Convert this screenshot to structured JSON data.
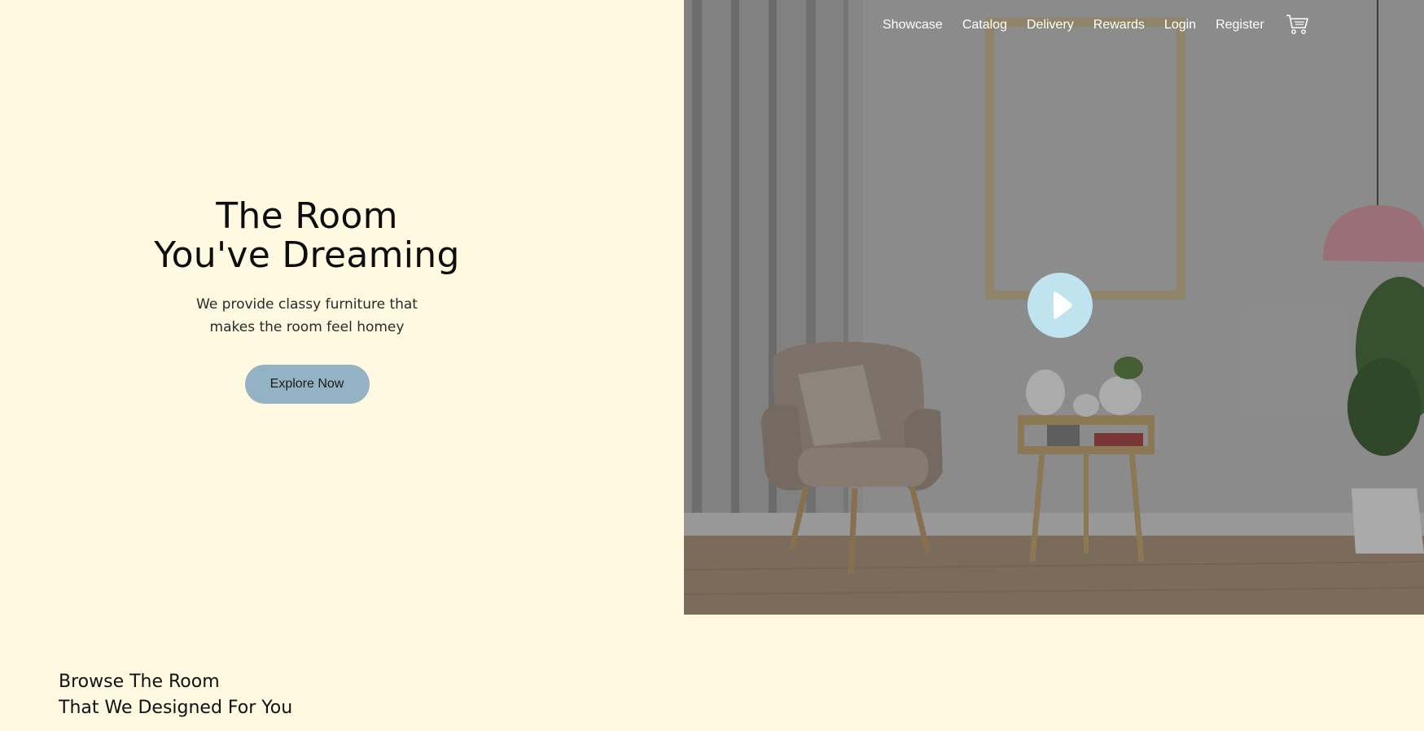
{
  "nav": {
    "items": [
      {
        "label": "Showcase"
      },
      {
        "label": "Catalog"
      },
      {
        "label": "Delivery"
      },
      {
        "label": "Rewards"
      },
      {
        "label": "Login"
      },
      {
        "label": "Register"
      }
    ],
    "cart_icon": "cart-icon"
  },
  "hero": {
    "title_line1": "The Room",
    "title_line2": "You've Dreaming",
    "subtitle_line1": "We provide classy furniture that",
    "subtitle_line2": "makes the room feel homey",
    "cta_label": "Explore Now",
    "play_icon": "play-icon"
  },
  "browse": {
    "line1": "Browse The Room",
    "line2": "That We Designed For You"
  },
  "colors": {
    "background": "#fef9e0",
    "cta": "#93b2c4",
    "play": "#bfe3ef",
    "text": "#111111",
    "nav_text": "#ffffff"
  }
}
